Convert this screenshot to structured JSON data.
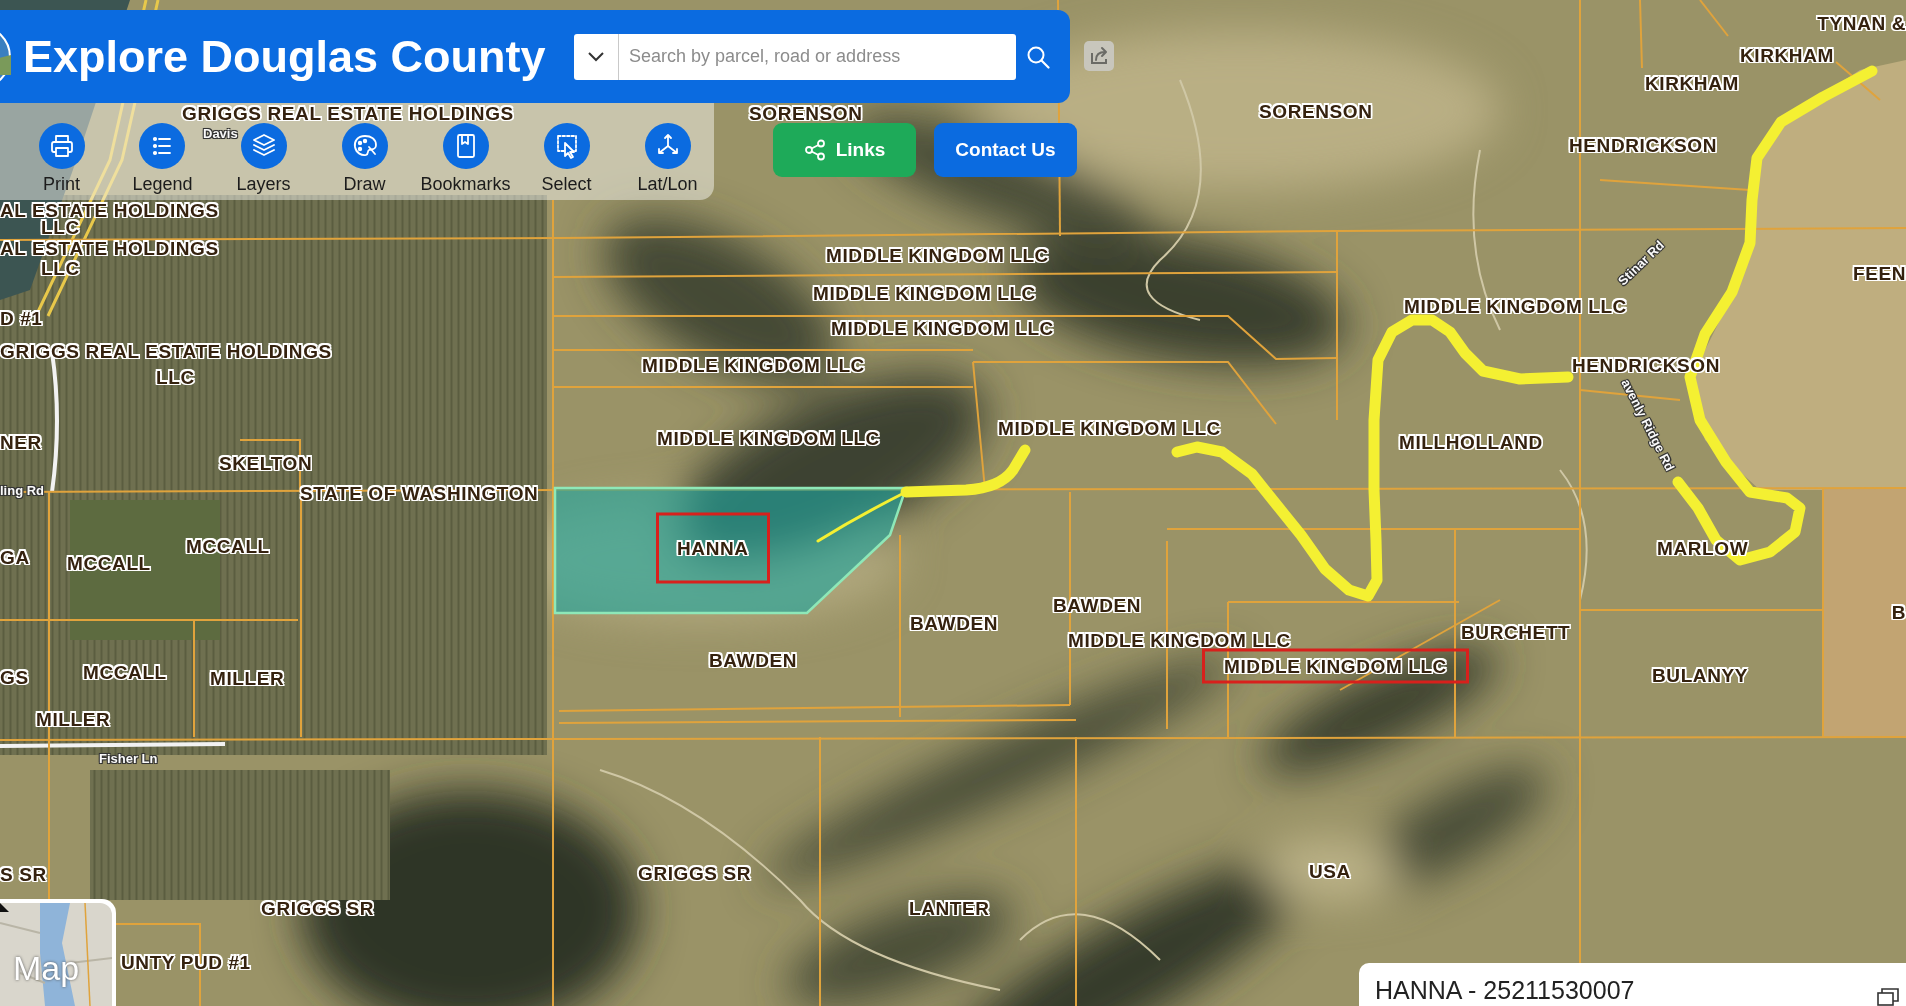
{
  "header": {
    "title": "Explore Douglas County",
    "search": {
      "placeholder": "Search by parcel, road or address"
    }
  },
  "toolbar": {
    "tools": [
      {
        "kind": "print",
        "label": "Print"
      },
      {
        "kind": "legend",
        "label": "Legend"
      },
      {
        "kind": "layers",
        "label": "Layers"
      },
      {
        "kind": "draw",
        "label": "Draw"
      },
      {
        "kind": "bookmarks",
        "label": "Bookmarks"
      },
      {
        "kind": "select",
        "label": "Select"
      },
      {
        "kind": "latlon",
        "label": "Lat/Lon"
      }
    ]
  },
  "actions": [
    {
      "kind": "links",
      "label": "Links"
    },
    {
      "kind": "contact",
      "label": "Contact Us"
    }
  ],
  "map": {
    "labels": [
      {
        "text": "TYNAN &",
        "kind": "owner",
        "framed": false
      },
      {
        "text": "KIRKHAM",
        "kind": "owner",
        "framed": false
      },
      {
        "text": "KIRKHAM",
        "kind": "owner",
        "framed": false
      },
      {
        "text": "GRIGGS REAL ESTATE HOLDINGS",
        "kind": "owner",
        "framed": false
      },
      {
        "text": "SORENSON",
        "kind": "owner",
        "framed": false
      },
      {
        "text": "SORENSON",
        "kind": "owner",
        "framed": false
      },
      {
        "text": "Davis",
        "kind": "road",
        "framed": false
      },
      {
        "text": "HENDRICKSON",
        "kind": "owner",
        "framed": false
      },
      {
        "text": "AL ESTATE HOLDINGS",
        "kind": "owner",
        "framed": false
      },
      {
        "text": "LLC",
        "kind": "owner",
        "framed": false
      },
      {
        "text": "AL ESTATE HOLDINGS",
        "kind": "owner",
        "framed": false
      },
      {
        "text": "LLC",
        "kind": "owner",
        "framed": false
      },
      {
        "text": "MIDDLE KINGDOM LLC",
        "kind": "owner",
        "framed": false
      },
      {
        "text": "MIDDLE KINGDOM LLC",
        "kind": "owner",
        "framed": false
      },
      {
        "text": "Stinar Rd",
        "kind": "road",
        "framed": false
      },
      {
        "text": "FEEN",
        "kind": "owner",
        "framed": false
      },
      {
        "text": "D #1",
        "kind": "owner",
        "framed": false
      },
      {
        "text": "MIDDLE KINGDOM LLC",
        "kind": "owner",
        "framed": false
      },
      {
        "text": "MIDDLE KINGDOM LLC",
        "kind": "owner",
        "framed": false
      },
      {
        "text": "GRIGGS REAL ESTATE HOLDINGS",
        "kind": "owner",
        "framed": false
      },
      {
        "text": "LLC",
        "kind": "owner",
        "framed": false
      },
      {
        "text": "MIDDLE KINGDOM LLC",
        "kind": "owner",
        "framed": false
      },
      {
        "text": "HENDRICKSON",
        "kind": "owner",
        "framed": false
      },
      {
        "text": "NER",
        "kind": "owner",
        "framed": false
      },
      {
        "text": "MIDDLE KINGDOM LLC",
        "kind": "owner",
        "framed": false
      },
      {
        "text": "MIDDLE KINGDOM LLC",
        "kind": "owner",
        "framed": false
      },
      {
        "text": "MILLHOLLAND",
        "kind": "owner",
        "framed": false
      },
      {
        "text": "SKELTON",
        "kind": "owner",
        "framed": false
      },
      {
        "text": "avenly Ridge Rd",
        "kind": "road",
        "framed": false
      },
      {
        "text": "ling Rd",
        "kind": "road",
        "framed": false
      },
      {
        "text": "STATE OF WASHINGTON",
        "kind": "owner",
        "framed": false
      },
      {
        "text": "GA",
        "kind": "owner",
        "framed": false
      },
      {
        "text": "MCCALL",
        "kind": "owner",
        "framed": false
      },
      {
        "text": "MCCALL",
        "kind": "owner",
        "framed": false
      },
      {
        "text": "HANNA",
        "kind": "owner",
        "framed": true
      },
      {
        "text": "MARLOW",
        "kind": "owner",
        "framed": false
      },
      {
        "text": "BAWDEN",
        "kind": "owner",
        "framed": false
      },
      {
        "text": "BAWDEN",
        "kind": "owner",
        "framed": false
      },
      {
        "text": "B",
        "kind": "owner",
        "framed": false
      },
      {
        "text": "MIDDLE KINGDOM LLC",
        "kind": "owner",
        "framed": false
      },
      {
        "text": "BURCHETT",
        "kind": "owner",
        "framed": false
      },
      {
        "text": "GS",
        "kind": "owner",
        "framed": false
      },
      {
        "text": "MCCALL",
        "kind": "owner",
        "framed": false
      },
      {
        "text": "MILLER",
        "kind": "owner",
        "framed": false
      },
      {
        "text": "BAWDEN",
        "kind": "owner",
        "framed": false
      },
      {
        "text": "MIDDLE KINGDOM LLC",
        "kind": "owner",
        "framed": true
      },
      {
        "text": "BULANYY",
        "kind": "owner",
        "framed": false
      },
      {
        "text": "MILLER",
        "kind": "owner",
        "framed": false
      },
      {
        "text": "Fisher Ln",
        "kind": "road",
        "framed": false
      },
      {
        "text": "S SR",
        "kind": "owner",
        "framed": false
      },
      {
        "text": "GRIGGS SR",
        "kind": "owner",
        "framed": false
      },
      {
        "text": "USA",
        "kind": "owner",
        "framed": false
      },
      {
        "text": "GRIGGS SR",
        "kind": "owner",
        "framed": false
      },
      {
        "text": "LANTER",
        "kind": "owner",
        "framed": false
      },
      {
        "text": "UNTY PUD #1",
        "kind": "owner",
        "framed": false
      }
    ]
  },
  "basemap_toggle": {
    "label": "Map"
  },
  "parcel_panel": {
    "title": "HANNA - 25211530007"
  }
}
